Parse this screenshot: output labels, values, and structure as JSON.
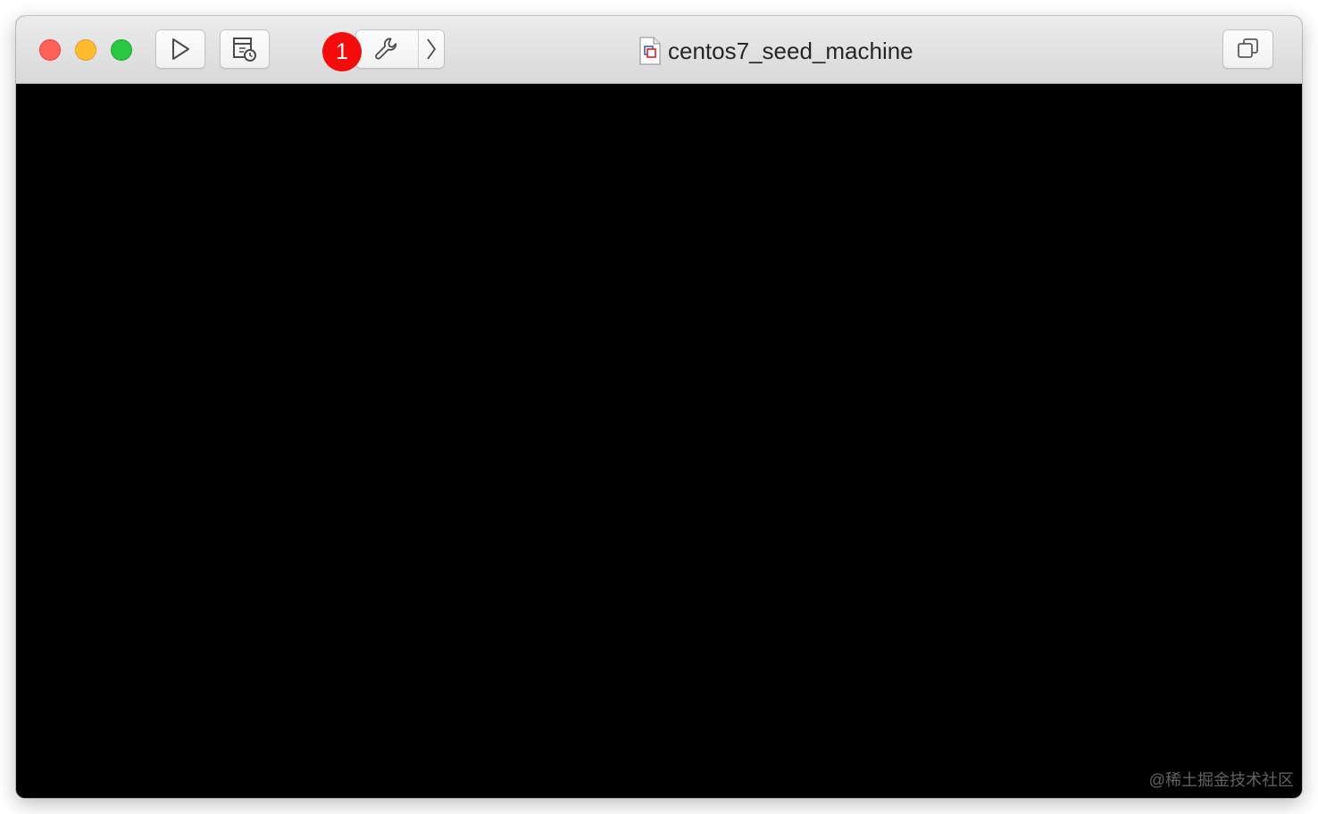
{
  "window": {
    "title": "centos7_seed_machine"
  },
  "toolbar": {
    "play_icon": "play-icon",
    "snapshot_icon": "snapshot-icon",
    "settings_icon": "wrench-icon",
    "next_icon": "chevron-right-icon",
    "fullscreen_icon": "fullscreen-icon",
    "callout_number": "1",
    "callout_color": "#f40b0b"
  },
  "traffic_lights": {
    "close_color": "#ff5f57",
    "minimize_color": "#ffbd2e",
    "maximize_color": "#28c940"
  },
  "screen": {
    "background": "#000000",
    "watermark": "@稀土掘金技术社区"
  }
}
